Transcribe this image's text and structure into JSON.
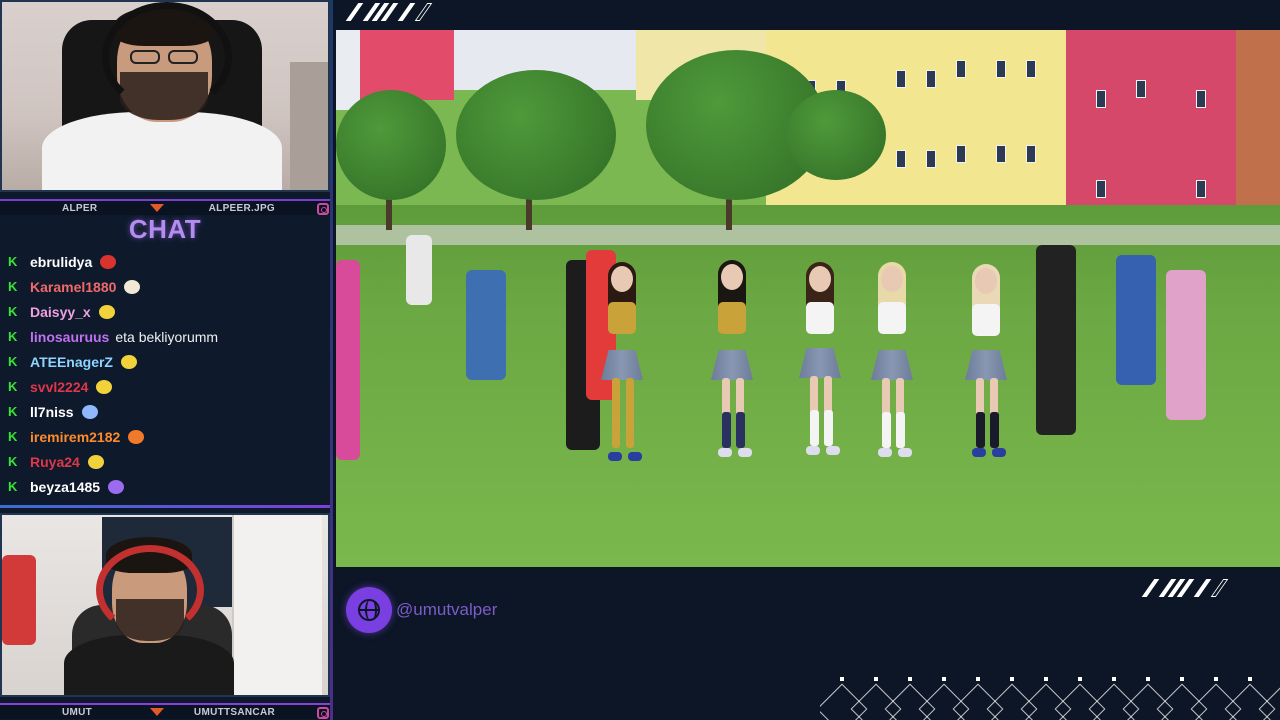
{
  "webcams": {
    "top": {
      "left_name": "ALPER",
      "right_name": "ALPEER.JPG"
    },
    "bottom": {
      "left_name": "UMUT",
      "right_name": "UMUTTSANCAR"
    }
  },
  "chat": {
    "title": "CHAT",
    "messages": [
      {
        "user": "ebrulidya",
        "color": "#ffffff",
        "text": "",
        "emote": "red-hat-emote"
      },
      {
        "user": "Karamel1880",
        "color": "#f06a6a",
        "text": "",
        "emote": "hand-emote"
      },
      {
        "user": "Daisyy_x",
        "color": "#f0a0e0",
        "text": "",
        "emote": "yellow-emote"
      },
      {
        "user": "linosauruus",
        "color": "#c070f0",
        "text": "eta bekliyorumm",
        "emote": ""
      },
      {
        "user": "ATEEnagerZ",
        "color": "#8fd3ff",
        "text": "",
        "emote": "yellow-emote"
      },
      {
        "user": "svvl2224",
        "color": "#e0364a",
        "text": "",
        "emote": "yellow-emote"
      },
      {
        "user": "ll7niss",
        "color": "#ffffff",
        "text": "",
        "emote": "butterfly-emote"
      },
      {
        "user": "iremirem2182",
        "color": "#ff8a2a",
        "text": "",
        "emote": "cat-emote"
      },
      {
        "user": "Ruya24",
        "color": "#e0364a",
        "text": "",
        "emote": "yellow-emote"
      },
      {
        "user": "beyza1485",
        "color": "#ffffff",
        "text": "",
        "emote": "heart-emote"
      }
    ]
  },
  "footer": {
    "handle": "@umutvalper"
  },
  "colors": {
    "accent": "#7a3fe0",
    "kick_green": "#37e337",
    "background": "#0c1626"
  }
}
